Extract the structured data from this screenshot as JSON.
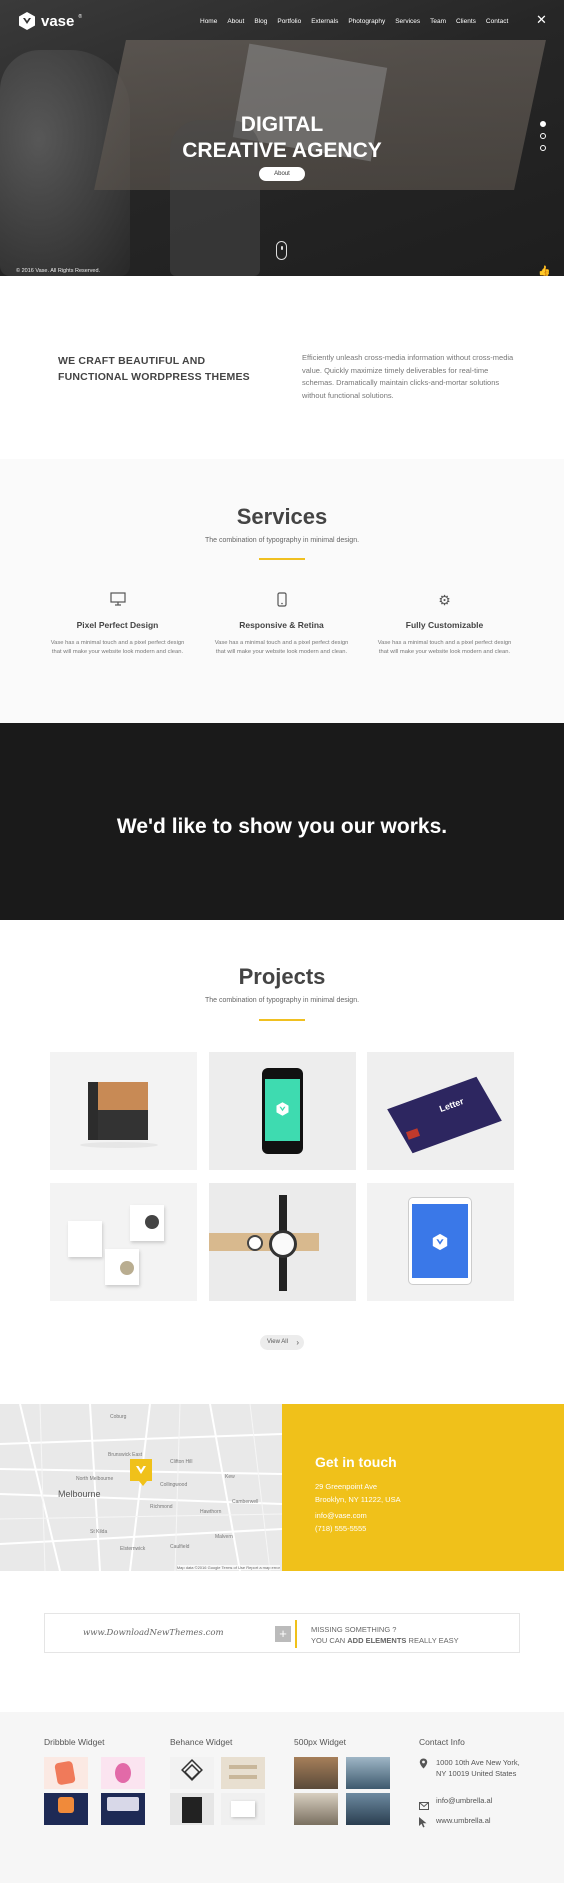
{
  "brand": {
    "name": "vase",
    "reg": "®"
  },
  "nav": {
    "items": [
      "Home",
      "About",
      "Blog",
      "Portfolio",
      "Externals",
      "Photography",
      "Services",
      "Team",
      "Clients",
      "Contact"
    ]
  },
  "hero": {
    "title_line1": "DIGITAL",
    "title_line2": "CREATIVE AGENCY",
    "button": "About",
    "copyright": "© 2016 Vase. All Rights Reserved."
  },
  "intro": {
    "heading": "WE CRAFT BEAUTIFUL AND FUNCTIONAL WORDPRESS THEMES",
    "text": "Efficiently unleash cross-media information without cross-media value. Quickly maximize timely deliverables for real-time schemas. Dramatically maintain clicks-and-mortar solutions without functional solutions."
  },
  "services": {
    "title": "Services",
    "subtitle": "The combination of typography in minimal design.",
    "items": [
      {
        "icon": "monitor-icon",
        "title": "Pixel Perfect Design",
        "text": "Vase has a minimal touch and a pixel perfect design that will make your website look modern and clean."
      },
      {
        "icon": "phone-icon",
        "title": "Responsive & Retina",
        "text": "Vase has a minimal touch and a pixel perfect design that will make your website look modern and clean."
      },
      {
        "icon": "gear-icon",
        "title": "Fully Customizable",
        "text": "Vase has a minimal touch and a pixel perfect design that will make your website look modern and clean."
      }
    ]
  },
  "works": {
    "title": "We'd like to show you our works."
  },
  "projects": {
    "title": "Projects",
    "subtitle": "The combination of typography in minimal design.",
    "view_all": "View All",
    "card_text": "Letter"
  },
  "map": {
    "city": "Melbourne",
    "labels": [
      "Brunswick East",
      "North Melbourne",
      "Clifton Hill",
      "Collingwood",
      "Richmond",
      "Hawthorn",
      "Camberwell",
      "Malvern",
      "Caulfield",
      "Elsternwick",
      "St Kilda",
      "Kew",
      "Coburg"
    ],
    "attribution": "Map data ©2016 Google   Terms of Use   Report a map error"
  },
  "contact": {
    "title": "Get in touch",
    "address1": "29 Greenpoint Ave",
    "address2": "Brooklyn, NY 11222, USA",
    "email": "info@vase.com",
    "phone": "(718) 555-5555"
  },
  "addbar": {
    "watermark": "www.DownloadNewThemes.com",
    "line1": "MISSING SOMETHING ?",
    "line2_pre": "YOU CAN ",
    "line2_bold": "ADD ELEMENTS",
    "line2_post": " REALLY EASY"
  },
  "footer": {
    "dribbble": "Dribbble Widget",
    "behance": "Behance Widget",
    "px500": "500px Widget",
    "contact": "Contact Info",
    "address": "1000 10th Ave New York, NY 10019 United States",
    "email": "info@umbrella.al",
    "web": "www.umbrella.al"
  },
  "colors": {
    "accent": "#f0c11a",
    "dark": "#1a1a1a"
  }
}
